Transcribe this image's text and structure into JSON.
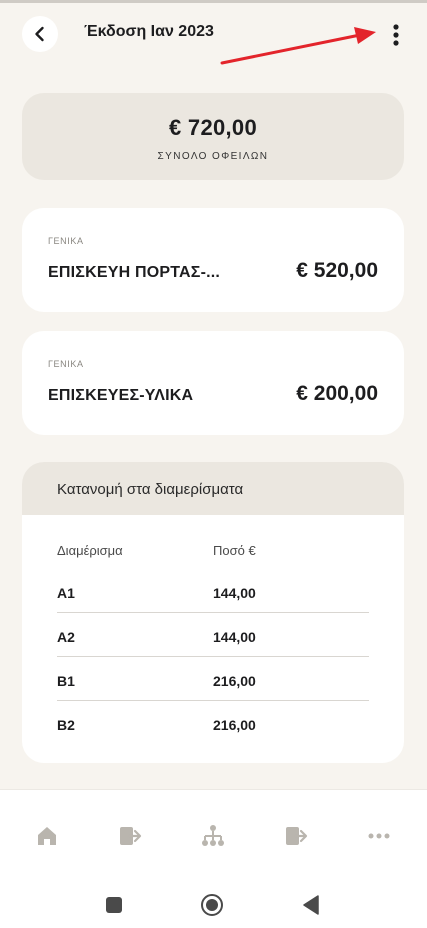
{
  "header": {
    "title": "Έκδοση Ιαν 2023",
    "back_icon": "chevron-left-icon",
    "more_icon": "vertical-dots-icon"
  },
  "summary": {
    "total_amount": "€ 720,00",
    "total_label": "ΣΥΝΟΛΟ ΟΦΕΙΛΩΝ"
  },
  "expenses": [
    {
      "category": "ΓΕΝΙΚΑ",
      "name": "ΕΠΙΣΚΕΥΗ ΠΟΡΤΑΣ-...",
      "amount": "€ 520,00"
    },
    {
      "category": "ΓΕΝΙΚΑ",
      "name": "ΕΠΙΣΚΕΥΕΣ-ΥΛΙΚΑ",
      "amount": "€ 200,00"
    }
  ],
  "allocation": {
    "title": "Κατανομή στα διαμερίσματα",
    "columns": [
      "Διαμέρισμα",
      "Ποσό €"
    ],
    "rows": [
      {
        "apartment": "A1",
        "amount": "144,00"
      },
      {
        "apartment": "A2",
        "amount": "144,00"
      },
      {
        "apartment": "B1",
        "amount": "216,00"
      },
      {
        "apartment": "B2",
        "amount": "216,00"
      }
    ]
  },
  "bottom_nav": [
    "home-icon",
    "wallet-exit-icon",
    "hierarchy-icon",
    "wallet-exit-icon",
    "more-horizontal-icon"
  ],
  "system_nav": [
    "recent-apps-icon",
    "home-circle-icon",
    "back-triangle-icon"
  ],
  "colors": {
    "background": "#f7f4ef",
    "card": "#ffffff",
    "card_muted": "#ebe7e0",
    "annotation_arrow": "#e3242b",
    "nav_icon": "#b9b5ae"
  }
}
